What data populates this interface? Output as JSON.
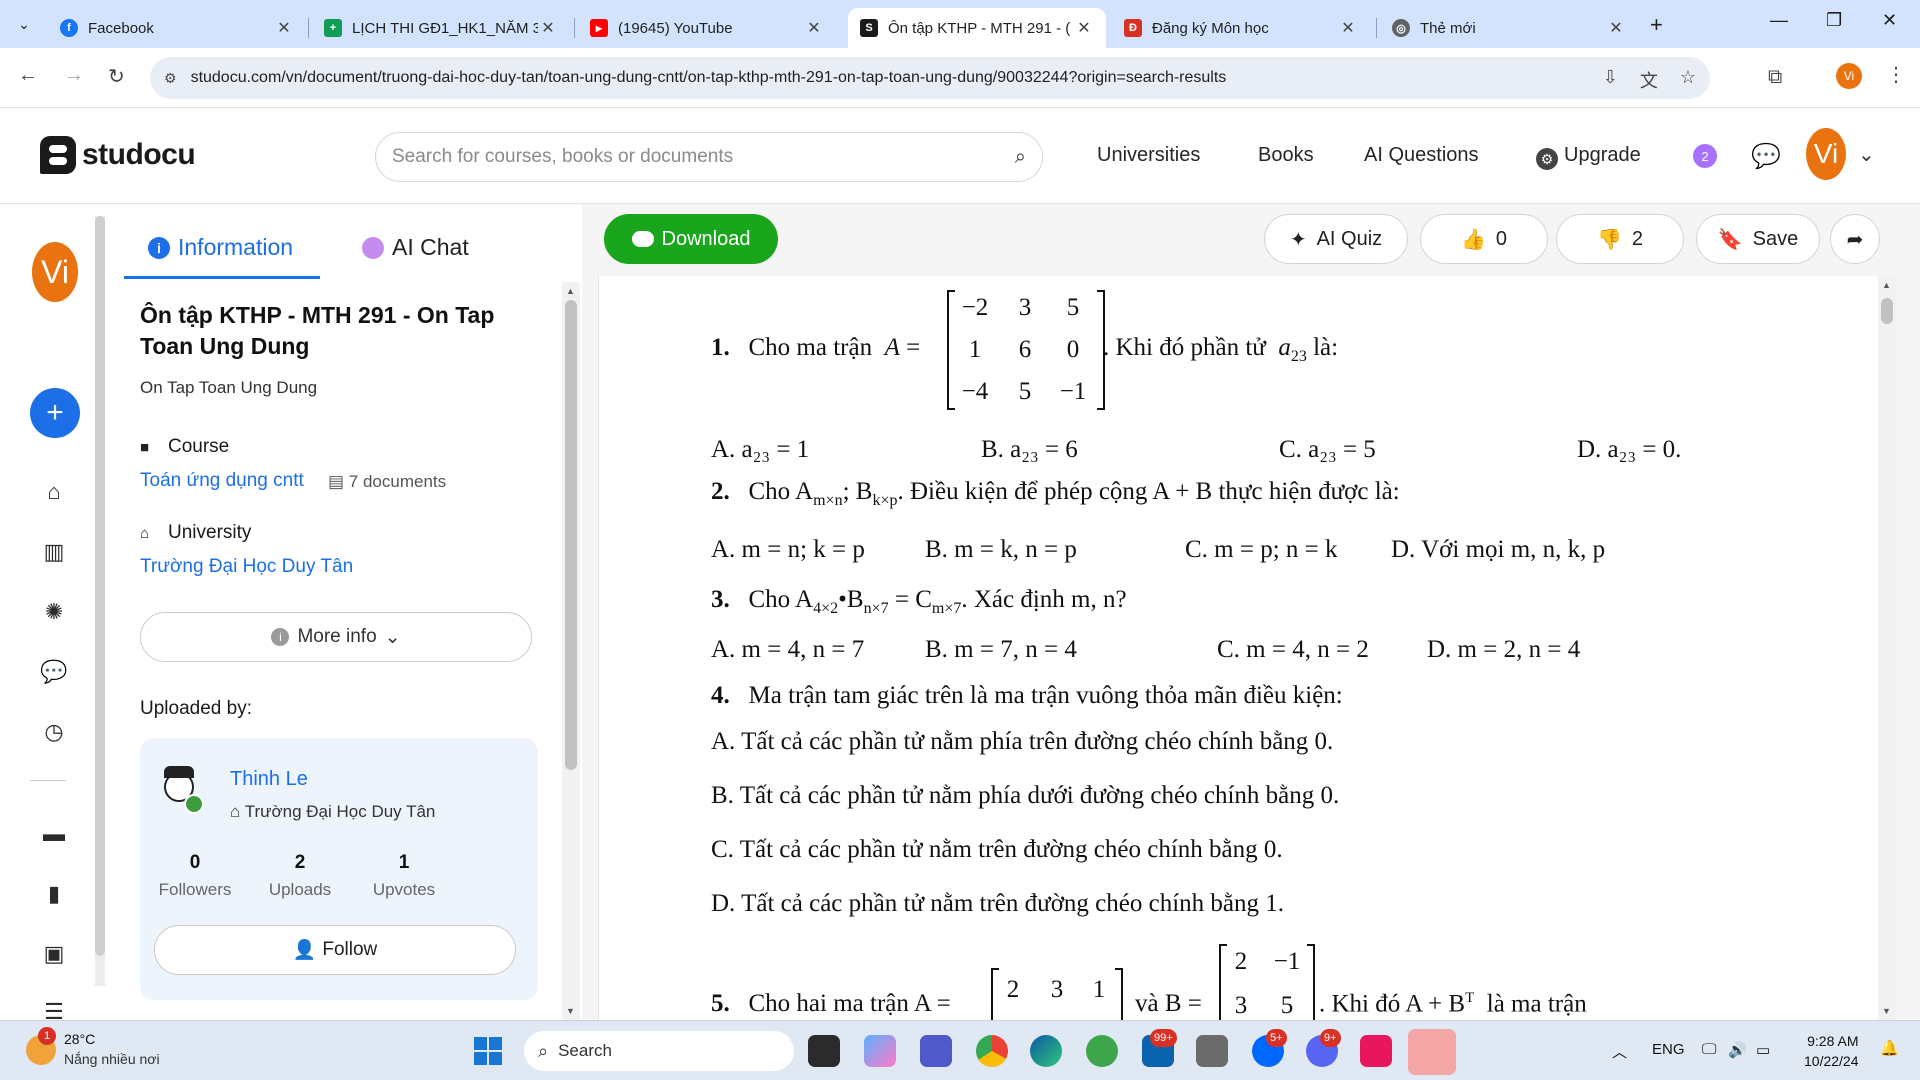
{
  "browser": {
    "tabs": [
      {
        "label": "Facebook",
        "color": "#1877f2",
        "glyph": "f"
      },
      {
        "label": "LỊCH THI GĐ1_HK1_NĂM 3",
        "color": "#0f9d58",
        "glyph": "+"
      },
      {
        "label": "(19645) YouTube",
        "color": "#ff0000",
        "glyph": "▶"
      },
      {
        "label": "Ôn tập KTHP - MTH 291 - (",
        "color": "#1a1a1a",
        "glyph": "S"
      },
      {
        "label": "Đăng ký Môn học",
        "color": "#d93025",
        "glyph": "Đ"
      },
      {
        "label": "Thẻ mới",
        "color": "#5f6368",
        "glyph": "◎"
      }
    ],
    "url": "studocu.com/vn/document/truong-dai-hoc-duy-tan/toan-ung-dung-cntt/on-tap-kthp-mth-291-on-tap-toan-ung-dung/90032244?origin=search-results",
    "profile": "Vi"
  },
  "header": {
    "logo": "studocu",
    "search_placeholder": "Search for courses, books or documents",
    "nav": [
      "Universities",
      "Books",
      "AI Questions",
      "Upgrade"
    ],
    "notifications": "2",
    "avatar": "Vi"
  },
  "rail": {
    "avatar": "Vi",
    "icons": [
      "home-icon",
      "library-icon",
      "brain-icon",
      "chat-icon",
      "history-icon",
      "folder-icon",
      "book-icon",
      "books-stack-icon"
    ]
  },
  "panel": {
    "tab_information": "Information",
    "tab_ai_chat": "AI Chat",
    "title": "Ôn tập KTHP - MTH 291 - On Tap Toan Ung Dung",
    "subtitle": "On Tap Toan Ung Dung",
    "course_label": "Course",
    "course_link": "Toán ứng dụng cntt",
    "course_docs": "7 documents",
    "university_label": "University",
    "university_link": "Trường Đại Học Duy Tân",
    "more_info": "More info",
    "uploaded_by": "Uploaded by:",
    "uploader": {
      "name": "Thinh Le",
      "university": "Trường Đại Học Duy Tân",
      "stats": [
        {
          "num": "0",
          "label": "Followers"
        },
        {
          "num": "2",
          "label": "Uploads"
        },
        {
          "num": "1",
          "label": "Upvotes"
        }
      ],
      "follow": "Follow"
    }
  },
  "toolbar": {
    "download": "Download",
    "ai_quiz": "AI Quiz",
    "likes": "0",
    "dislikes": "2",
    "save": "Save"
  },
  "document": {
    "q1": {
      "num": "1.",
      "text": "Cho ma trận",
      "after": ". Khi đó phần tử",
      "elem": "a",
      "sub": "23",
      "tail": "là:",
      "matrix": [
        [
          "−2",
          "3",
          "5"
        ],
        [
          "1",
          "6",
          "0"
        ],
        [
          "−4",
          "5",
          "−1"
        ]
      ],
      "options": [
        "A. a₂₃ = 1",
        "B. a₂₃ = 6",
        "C. a₂₃ = 5",
        "D. a₂₃ = 0."
      ]
    },
    "q2": {
      "num": "2.",
      "text": "Cho A",
      "sub1": "m×n",
      "mid": "; B",
      "sub2": "k×p",
      "tail": ". Điều kiện để phép cộng A + B thực hiện được là:",
      "options": [
        "A. m = n; k = p",
        "B. m = k, n = p",
        "C. m = p; n = k",
        "D. Với mọi m, n, k, p"
      ]
    },
    "q3": {
      "num": "3.",
      "text": "Cho A",
      "sub1": "4×2",
      "mid1": "•B",
      "sub2": "n×7",
      "mid2": "= C",
      "sub3": "m×7",
      "tail": ". Xác định m, n?",
      "options": [
        "A.  m = 4, n = 7",
        "B. m = 7, n = 4",
        "C. m = 4, n = 2",
        "D. m = 2, n = 4"
      ]
    },
    "q4": {
      "num": "4.",
      "text": "Ma trận tam giác trên là ma trận vuông thỏa mãn điều kiện:",
      "options": [
        "A. Tất cả các phần tử nằm phía trên đường chéo chính bằng 0.",
        "B. Tất cả các phần tử nằm phía dưới đường chéo chính bằng 0.",
        "C. Tất cả các phần tử nằm trên đường chéo chính bằng 0.",
        "D. Tất cả các phần tử nằm trên đường chéo chính bằng 1."
      ]
    },
    "q5": {
      "num": "5.",
      "text": "Cho hai ma trận A =",
      "matA_row1": [
        "2",
        "3",
        "1"
      ],
      "mid": "và B =",
      "matB_rows": [
        [
          "2",
          "−1"
        ],
        [
          "3",
          "5"
        ]
      ],
      "tail": ". Khi đó A + B",
      "sup": "T",
      "tail2": "là ma trận"
    }
  },
  "taskbar": {
    "weather_temp": "28°C",
    "weather_desc": "Nắng nhiều nơi",
    "weather_badge": "1",
    "search": "Search",
    "badges": {
      "mail": "99+",
      "zalo": "5+",
      "discord": "9+"
    },
    "lang": "ENG",
    "time": "9:28 AM",
    "date": "10/22/24"
  }
}
